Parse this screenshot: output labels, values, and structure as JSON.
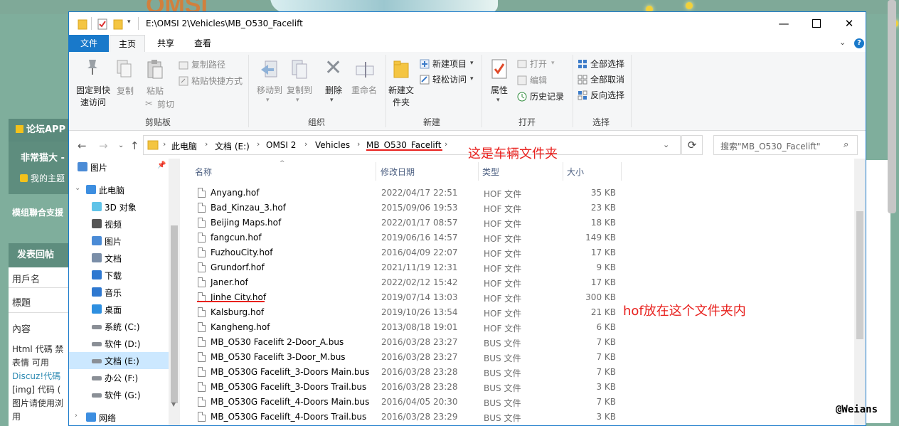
{
  "window": {
    "path_title": "E:\\OMSI 2\\Vehicles\\MB_O530_Facelift"
  },
  "ribbon_tabs": [
    "文件",
    "主页",
    "共享",
    "查看"
  ],
  "ribbon": {
    "clipboard": {
      "pin": "固定到快速访问",
      "copy": "复制",
      "paste": "粘贴",
      "copy_path": "复制路径",
      "paste_shortcut": "粘贴快捷方式",
      "cut": "剪切",
      "group": "剪贴板"
    },
    "organize": {
      "move_to": "移动到",
      "copy_to": "复制到",
      "delete": "删除",
      "rename": "重命名",
      "group": "组织"
    },
    "new": {
      "new_folder": "新建文件夹",
      "new_item": "新建项目",
      "easy_access": "轻松访问",
      "group": "新建"
    },
    "open": {
      "properties": "属性",
      "open": "打开",
      "edit": "编辑",
      "history": "历史记录",
      "group": "打开"
    },
    "select": {
      "select_all": "全部选择",
      "select_none": "全部取消",
      "invert": "反向选择",
      "group": "选择"
    }
  },
  "breadcrumb": [
    "此电脑",
    "文档 (E:)",
    "OMSI 2",
    "Vehicles",
    "MB_O530_Facelift"
  ],
  "search": {
    "placeholder": "搜索\"MB_O530_Facelift\""
  },
  "annotations": {
    "vehicle_folder": "这是车辆文件夹",
    "hof_here": "hof放在这个文件夹内"
  },
  "nav_pane": [
    {
      "label": "图片",
      "icon": "pictures-icon",
      "pinned": true
    },
    {
      "label": "此电脑",
      "icon": "this-pc-icon"
    },
    {
      "label": "3D 对象",
      "icon": "3d-objects-icon"
    },
    {
      "label": "视频",
      "icon": "videos-icon"
    },
    {
      "label": "图片",
      "icon": "pictures-icon"
    },
    {
      "label": "文档",
      "icon": "documents-icon"
    },
    {
      "label": "下载",
      "icon": "downloads-icon"
    },
    {
      "label": "音乐",
      "icon": "music-icon"
    },
    {
      "label": "桌面",
      "icon": "desktop-icon"
    },
    {
      "label": "系统 (C:)",
      "icon": "drive-icon"
    },
    {
      "label": "软件 (D:)",
      "icon": "drive-icon"
    },
    {
      "label": "文档 (E:)",
      "icon": "drive-icon",
      "selected": true
    },
    {
      "label": "办公 (F:)",
      "icon": "drive-icon"
    },
    {
      "label": "软件 (G:)",
      "icon": "drive-icon"
    },
    {
      "label": "网络",
      "icon": "network-icon"
    }
  ],
  "columns": {
    "name": "名称",
    "date": "修改日期",
    "type": "类型",
    "size": "大小"
  },
  "files": [
    {
      "name": "Anyang.hof",
      "date": "2022/04/17 22:51",
      "type": "HOF 文件",
      "size": "35 KB"
    },
    {
      "name": "Bad_Kinzau_3.hof",
      "date": "2015/09/06 19:53",
      "type": "HOF 文件",
      "size": "23 KB"
    },
    {
      "name": "Beijing Maps.hof",
      "date": "2022/01/17 08:57",
      "type": "HOF 文件",
      "size": "18 KB"
    },
    {
      "name": "fangcun.hof",
      "date": "2019/06/16 14:57",
      "type": "HOF 文件",
      "size": "149 KB"
    },
    {
      "name": "FuzhouCity.hof",
      "date": "2016/04/09 22:07",
      "type": "HOF 文件",
      "size": "17 KB"
    },
    {
      "name": "Grundorf.hof",
      "date": "2021/11/19 12:31",
      "type": "HOF 文件",
      "size": "9 KB"
    },
    {
      "name": "Janer.hof",
      "date": "2022/02/12 15:42",
      "type": "HOF 文件",
      "size": "17 KB"
    },
    {
      "name": "Jinhe City.hof",
      "date": "2019/07/14 13:03",
      "type": "HOF 文件",
      "size": "300 KB"
    },
    {
      "name": "Kalsburg.hof",
      "date": "2019/10/26 13:54",
      "type": "HOF 文件",
      "size": "21 KB"
    },
    {
      "name": "Kangheng.hof",
      "date": "2013/08/18 19:01",
      "type": "HOF 文件",
      "size": "6 KB"
    },
    {
      "name": "MB_O530 Facelift 2-Door_A.bus",
      "date": "2016/03/28 23:27",
      "type": "BUS 文件",
      "size": "7 KB"
    },
    {
      "name": "MB_O530 Facelift 3-Door_M.bus",
      "date": "2016/03/28 23:27",
      "type": "BUS 文件",
      "size": "7 KB"
    },
    {
      "name": "MB_O530G Facelift_3-Doors Main.bus",
      "date": "2016/03/28 23:28",
      "type": "BUS 文件",
      "size": "7 KB"
    },
    {
      "name": "MB_O530G Facelift_3-Doors Trail.bus",
      "date": "2016/03/28 23:28",
      "type": "BUS 文件",
      "size": "3 KB"
    },
    {
      "name": "MB_O530G Facelift_4-Doors Main.bus",
      "date": "2016/04/05 20:30",
      "type": "BUS 文件",
      "size": "7 KB"
    },
    {
      "name": "MB_O530G Facelift_4-Doors Trail.bus",
      "date": "2016/03/28 23:29",
      "type": "BUS 文件",
      "size": "3 KB"
    }
  ],
  "background_forum": {
    "forum_app": "论坛APP",
    "user": "非常猫大 -",
    "my_threads": "我的主题",
    "mod_text": "模组聯合支援",
    "reply_header": "发表回帖",
    "username_label": "用戶名",
    "subject_label": "標題",
    "content_label": "內容",
    "html_line": "Html 代碼 禁",
    "smiley_line": "表情 可用",
    "discuz_line": "Discuz!代碼",
    "img_line": "[img] 代码 (",
    "img_note": "图片请使用浏",
    "use": "用"
  },
  "watermark": "@Weians"
}
